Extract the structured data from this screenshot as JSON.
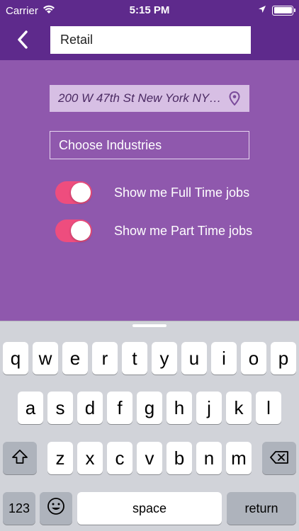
{
  "status_bar": {
    "carrier": "Carrier",
    "time": "5:15 PM",
    "icons": [
      "wifi-icon",
      "location-arrow-icon",
      "battery-icon"
    ]
  },
  "nav": {
    "back_icon": "chevron-left-icon",
    "search_value": "Retail"
  },
  "form": {
    "location_value": "200 W 47th St New York NY…",
    "location_icon": "map-pin-icon",
    "industries_label": "Choose Industries",
    "toggles": [
      {
        "label": "Show me Full Time jobs",
        "on": true
      },
      {
        "label": "Show me Part Time jobs",
        "on": true
      }
    ]
  },
  "keyboard": {
    "row1": [
      "q",
      "w",
      "e",
      "r",
      "t",
      "y",
      "u",
      "i",
      "o",
      "p"
    ],
    "row2": [
      "a",
      "s",
      "d",
      "f",
      "g",
      "h",
      "j",
      "k",
      "l"
    ],
    "row3": [
      "z",
      "x",
      "c",
      "v",
      "b",
      "n",
      "m"
    ],
    "shift_icon": "shift-icon",
    "delete_icon": "backspace-icon",
    "numbers_label": "123",
    "emoji_icon": "emoji-icon",
    "space_label": "space",
    "return_label": "return"
  },
  "colors": {
    "header": "#5e2a8c",
    "background": "#8f58ad",
    "toggle_on": "#ee4d7e",
    "location_field": "#d7bfe4"
  }
}
